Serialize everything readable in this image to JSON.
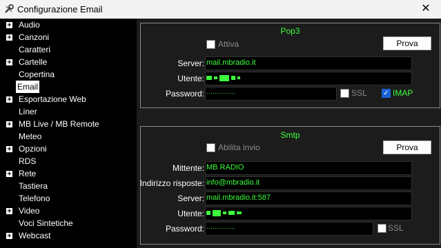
{
  "window": {
    "title": "Configurazione Email",
    "close_glyph": "✕"
  },
  "sidebar": {
    "items": [
      {
        "label": "Audio",
        "expandable": true
      },
      {
        "label": "Canzoni",
        "expandable": true
      },
      {
        "label": "Caratteri",
        "expandable": false
      },
      {
        "label": "Cartelle",
        "expandable": true
      },
      {
        "label": "Copertina",
        "expandable": false
      },
      {
        "label": "Email",
        "expandable": false,
        "selected": true
      },
      {
        "label": "Esportazione Web",
        "expandable": true
      },
      {
        "label": "Liner",
        "expandable": false
      },
      {
        "label": "MB Live / MB Remote",
        "expandable": true
      },
      {
        "label": "Meteo",
        "expandable": false
      },
      {
        "label": "Opzioni",
        "expandable": true
      },
      {
        "label": "RDS",
        "expandable": false
      },
      {
        "label": "Rete",
        "expandable": true
      },
      {
        "label": "Tastiera",
        "expandable": false
      },
      {
        "label": "Telefono",
        "expandable": false
      },
      {
        "label": "Video",
        "expandable": true
      },
      {
        "label": "Voci Sintetiche",
        "expandable": false
      },
      {
        "label": "Webcast",
        "expandable": true
      }
    ],
    "expand_glyph": "+"
  },
  "pop3": {
    "title": "Pop3",
    "attiva_label": "Attiva",
    "attiva_checked": false,
    "prova_label": "Prova",
    "server_label": "Server:",
    "server_value": "mail.mbradio.it",
    "utente_label": "Utente:",
    "password_label": "Password:",
    "password_value": "··············",
    "ssl_label": "SSL",
    "ssl_checked": false,
    "imap_label": "IMAP",
    "imap_checked": true
  },
  "smtp": {
    "title": "Smtp",
    "abilita_label": "Abilita invio",
    "abilita_checked": false,
    "prova_label": "Prova",
    "mittente_label": "Mittente:",
    "mittente_value": "MB RADIO",
    "risposte_label": "Indirizzo risposte:",
    "risposte_value": "info@mbradio.it",
    "server_label": "Server:",
    "server_value": "mail.mbradio.it:587",
    "utente_label": "Utente:",
    "password_label": "Password:",
    "password_value": "··············",
    "ssl_label": "SSL",
    "ssl_checked": false
  },
  "colors": {
    "accent_green": "#3dff3d",
    "panel_bg": "#1c1c1c",
    "field_bg": "#000000",
    "checkbox_checked": "#1a63d6"
  },
  "icons": {
    "app": "settings-icon",
    "close": "close-icon",
    "expand": "plus-box-icon",
    "check": "checkmark-icon"
  }
}
